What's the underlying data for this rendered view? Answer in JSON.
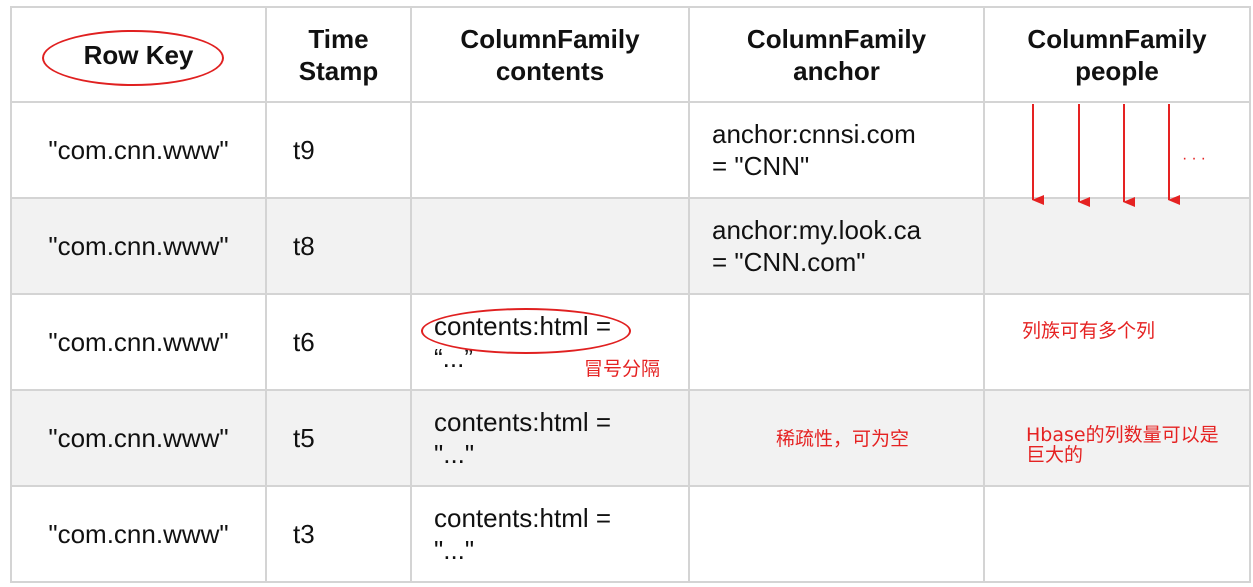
{
  "table": {
    "headers": [
      {
        "line1": "Row Key",
        "line2": ""
      },
      {
        "line1": "Time",
        "line2": "Stamp"
      },
      {
        "line1": "ColumnFamily",
        "line2": "contents"
      },
      {
        "line1": "ColumnFamily",
        "line2": "anchor"
      },
      {
        "line1": "ColumnFamily",
        "line2": "people"
      }
    ],
    "rows": [
      {
        "rowkey": "\"com.cnn.www\"",
        "timestamp": "t9",
        "contents_line1": "",
        "contents_line2": "",
        "anchor_line1": "anchor:cnnsi.com",
        "anchor_line2": "= \"CNN\"",
        "people": ""
      },
      {
        "rowkey": "\"com.cnn.www\"",
        "timestamp": "t8",
        "contents_line1": "",
        "contents_line2": "",
        "anchor_line1": "anchor:my.look.ca",
        "anchor_line2": "= \"CNN.com\"",
        "people": ""
      },
      {
        "rowkey": "\"com.cnn.www\"",
        "timestamp": "t6",
        "contents_line1": "contents:html =",
        "contents_line2": "“...”",
        "anchor_line1": "",
        "anchor_line2": "",
        "people": ""
      },
      {
        "rowkey": "\"com.cnn.www\"",
        "timestamp": "t5",
        "contents_line1": "contents:html =",
        "contents_line2": "\"...\"",
        "anchor_line1": "",
        "anchor_line2": "",
        "people": ""
      },
      {
        "rowkey": "\"com.cnn.www\"",
        "timestamp": "t3",
        "contents_line1": "contents:html =",
        "contents_line2": "\"...\"",
        "anchor_line1": "",
        "anchor_line2": "",
        "people": ""
      }
    ]
  },
  "annotations": {
    "colon_separator": "冒号分隔",
    "sparse": "稀疏性，可为空",
    "multi_column": "列族可有多个列",
    "huge_line1": "Hbase的列数量可以是",
    "huge_line2": "巨大的",
    "ellipsis": "···"
  },
  "colors": {
    "annotation_red": "#e52222",
    "shaded_row": "#f2f2f2",
    "border": "#d4d4d4"
  }
}
